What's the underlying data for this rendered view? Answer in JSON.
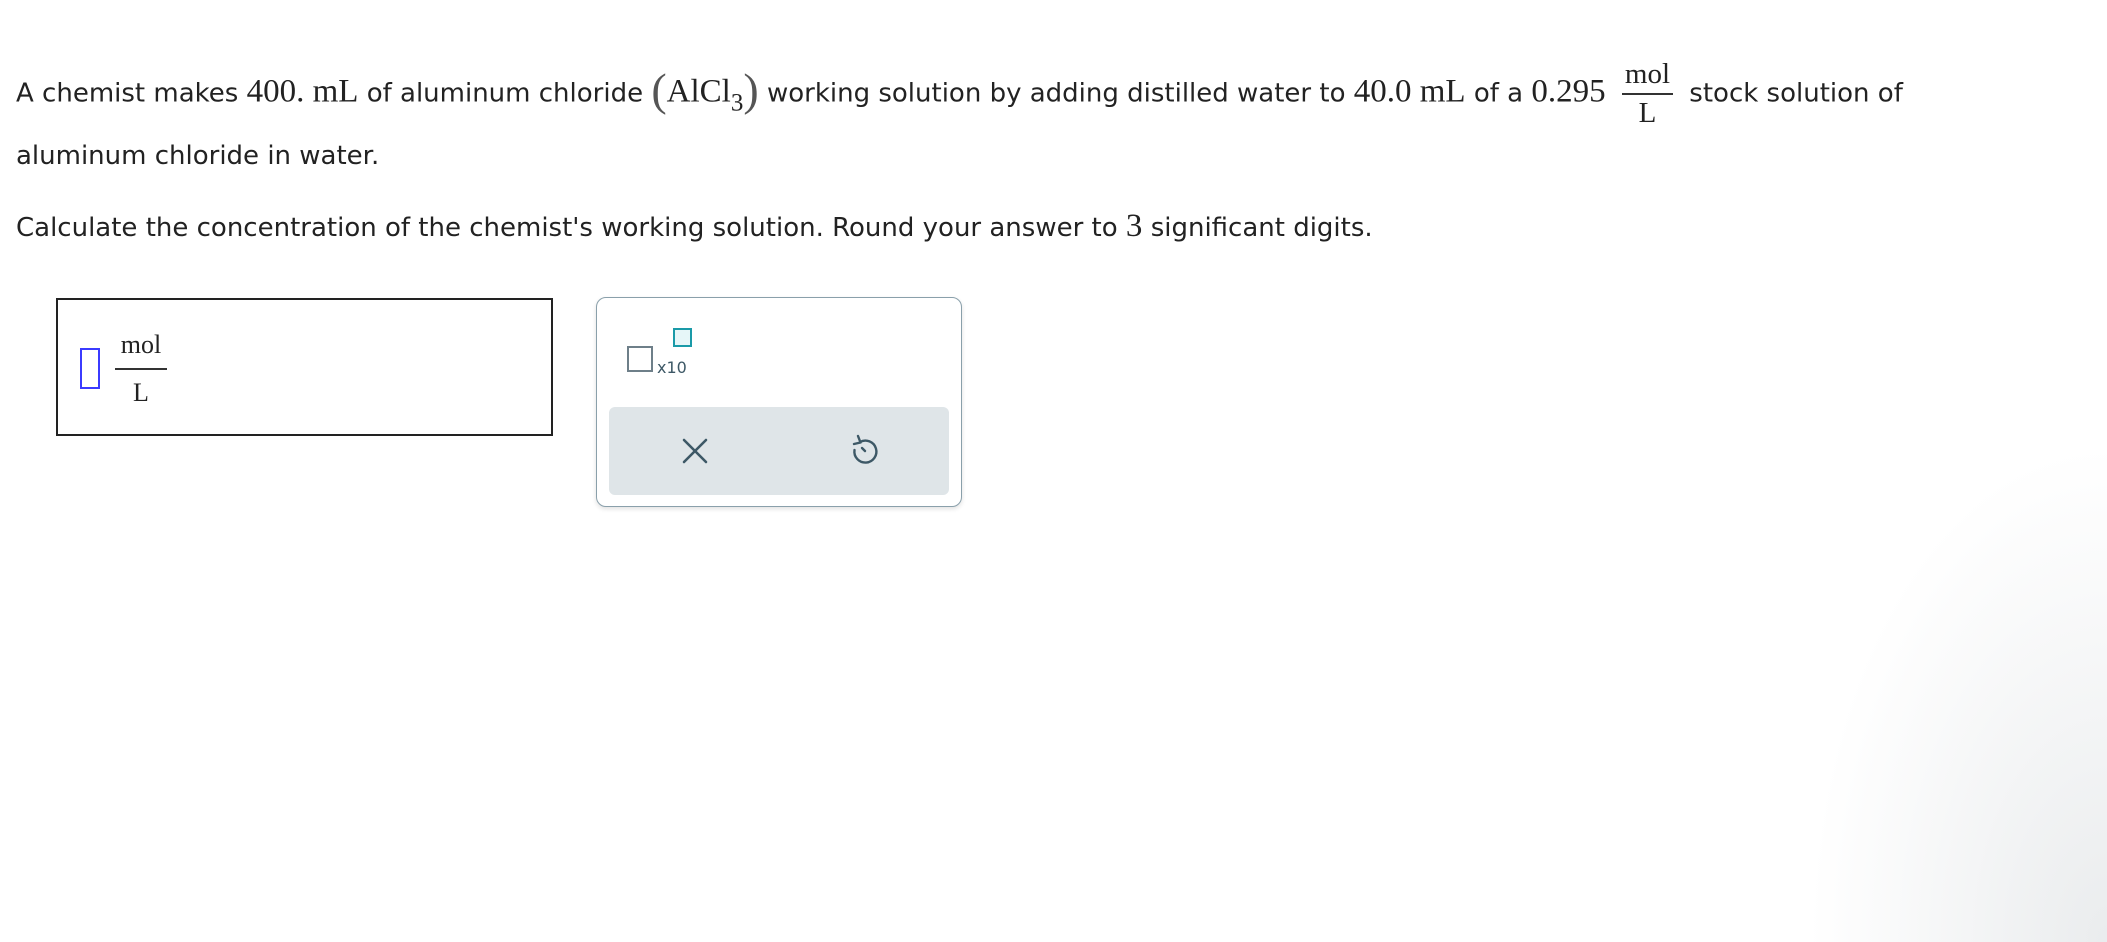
{
  "question": {
    "line1_a": "A chemist makes",
    "vol_working": "400.",
    "unit_ml_1": "mL",
    "line1_b": "of aluminum chloride",
    "formula_base": "AlCl",
    "formula_sub": "3",
    "line1_c": "working solution by adding distilled water to",
    "vol_stock": "40.0",
    "unit_ml_2": "mL",
    "line1_d": "of a",
    "stock_conc": "0.295",
    "unit_num": "mol",
    "unit_den": "L",
    "line1_e": "stock solution of",
    "line2": "aluminum chloride in water.",
    "instr_a": "Calculate the concentration of the chemist's working solution. Round your answer to",
    "sig_digits": "3",
    "instr_b": "significant digits."
  },
  "answer": {
    "value": "",
    "unit_num": "mol",
    "unit_den": "L"
  },
  "toolbox": {
    "x10_label": "x10",
    "icons": [
      "x10-exponent-icon",
      "clear-icon",
      "undo-icon"
    ],
    "accent_color": "#1a9aa8",
    "icon_color": "#3d5866"
  }
}
